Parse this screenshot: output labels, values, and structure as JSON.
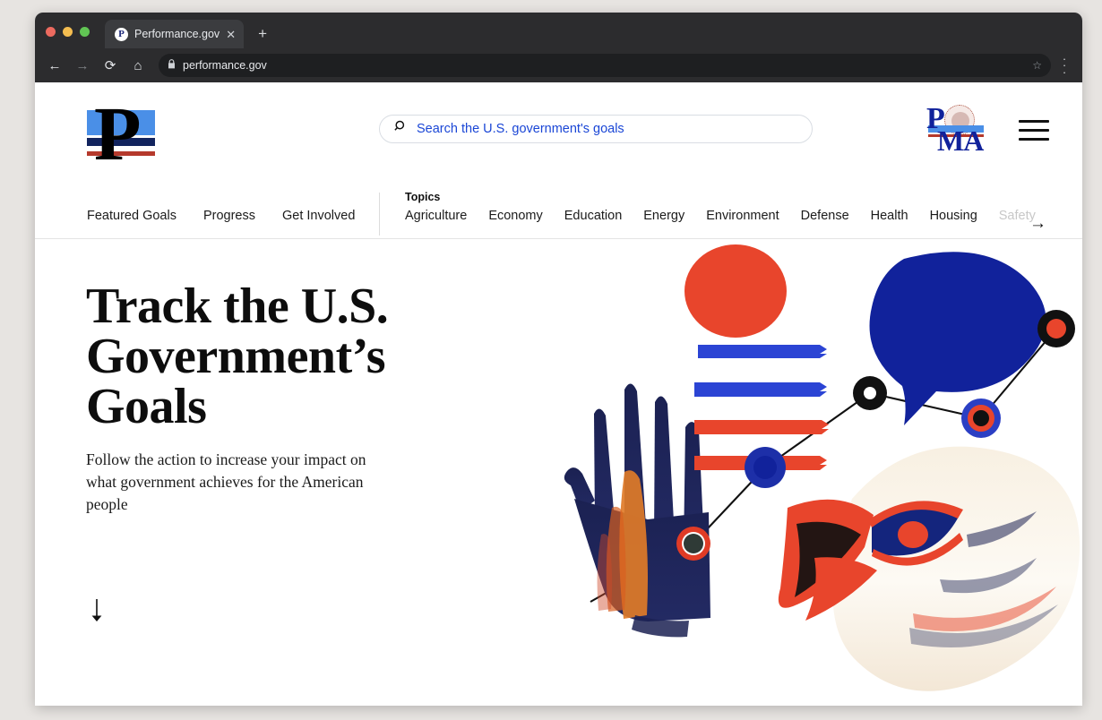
{
  "browser": {
    "tab": {
      "title": "Performance.gov",
      "favicon_letter": "P",
      "favicon_name": "performance-favicon",
      "close_label": "✕"
    },
    "new_tab_label": "+",
    "back_label": "←",
    "forward_label": "→",
    "reload_label": "⟳",
    "home_label": "⌂",
    "lock_label": "🔒",
    "url": "performance.gov",
    "bookmark_label": "☆",
    "menu_label": "⋮"
  },
  "header": {
    "logo_letter": "P",
    "search": {
      "placeholder": "Search the U.S. government's goals",
      "value": ""
    },
    "pma": {
      "p": "P",
      "ma": "MA"
    },
    "menu_label": "Menu"
  },
  "nav": {
    "primary": [
      {
        "label": "Featured Goals"
      },
      {
        "label": "Progress"
      },
      {
        "label": "Get Involved"
      }
    ],
    "topics_label": "Topics",
    "topics": [
      {
        "label": "Agriculture",
        "faded": false
      },
      {
        "label": "Economy",
        "faded": false
      },
      {
        "label": "Education",
        "faded": false
      },
      {
        "label": "Energy",
        "faded": false
      },
      {
        "label": "Environment",
        "faded": false
      },
      {
        "label": "Defense",
        "faded": false
      },
      {
        "label": "Health",
        "faded": false
      },
      {
        "label": "Housing",
        "faded": false
      },
      {
        "label": "Safety",
        "faded": true
      }
    ],
    "topics_next_label": "→"
  },
  "hero": {
    "title": "Track the U.S. Government’s Goals",
    "subtitle": "Follow the action to increase your impact on what government achieves for the American people",
    "scroll_label": "↓"
  },
  "colors": {
    "brand_blue": "#11229b",
    "link_blue": "#1a46d6",
    "stripe_blue": "#2b44d4",
    "red": "#e8452c",
    "navy": "#1b2152",
    "cream": "#f7efe2",
    "orange": "#e07b28"
  }
}
